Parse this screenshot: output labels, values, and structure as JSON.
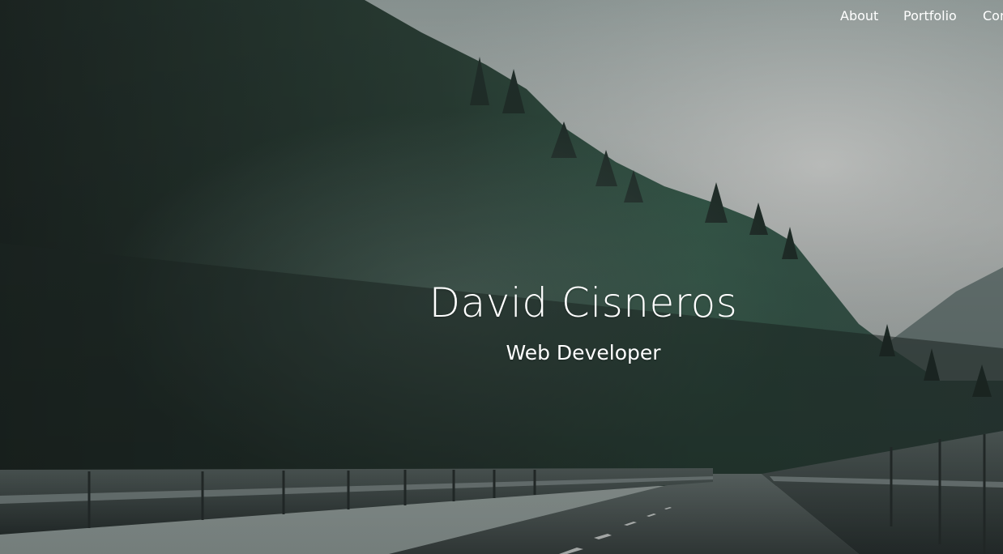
{
  "nav": {
    "items": [
      {
        "label": "About"
      },
      {
        "label": "Portfolio"
      },
      {
        "label": "Contact"
      }
    ]
  },
  "hero": {
    "name": "David Cisneros",
    "role": "Web Developer"
  }
}
